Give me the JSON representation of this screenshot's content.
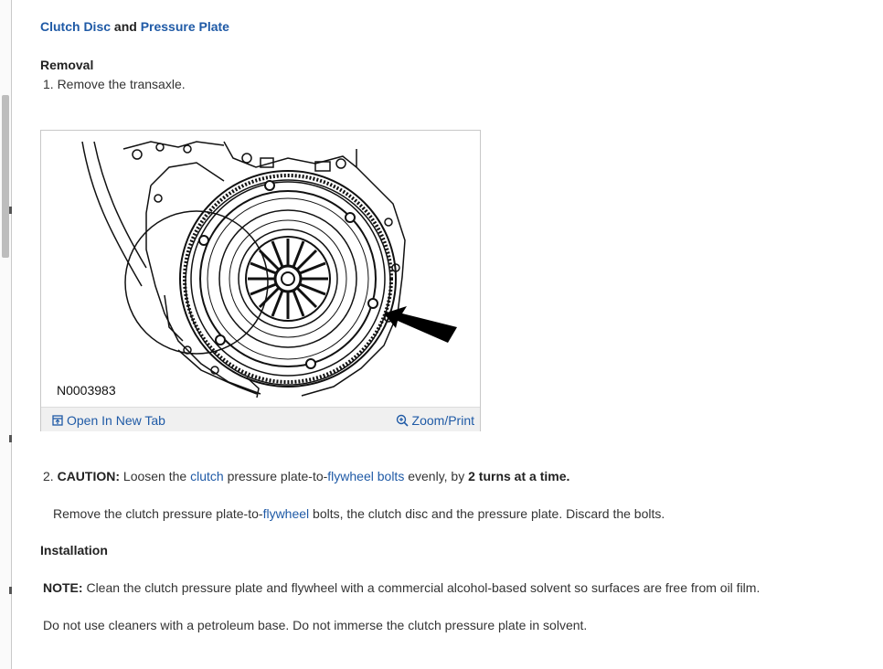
{
  "title": {
    "part1": "Clutch Disc",
    "joiner": "and",
    "part2": "Pressure Plate"
  },
  "removal": {
    "heading": "Removal",
    "step1": "1. Remove the transaxle."
  },
  "figure": {
    "code": "N0003983",
    "open_new_tab": "Open In New Tab",
    "zoom_print": "Zoom/Print"
  },
  "step2": {
    "number": "2.",
    "caution_label": "CAUTION:",
    "t1": "Loosen the",
    "link_clutch": "clutch",
    "t2": "pressure plate-to-",
    "link_flywheel_bolts": "flywheel bolts",
    "t3": "evenly, by",
    "bold_turns": "2 turns at a time."
  },
  "step2b": {
    "t1": "Remove the clutch pressure plate-to-",
    "link_flywheel": "flywheel",
    "t2": "bolts, the clutch disc and the pressure plate. Discard the bolts."
  },
  "installation": {
    "heading": "Installation",
    "note_label": "NOTE:",
    "note_text": "Clean the clutch pressure plate and flywheel with a commercial alcohol-based solvent so surfaces are free from oil film.",
    "line2": "Do not use cleaners with a petroleum base. Do not immerse the clutch pressure plate in solvent."
  }
}
